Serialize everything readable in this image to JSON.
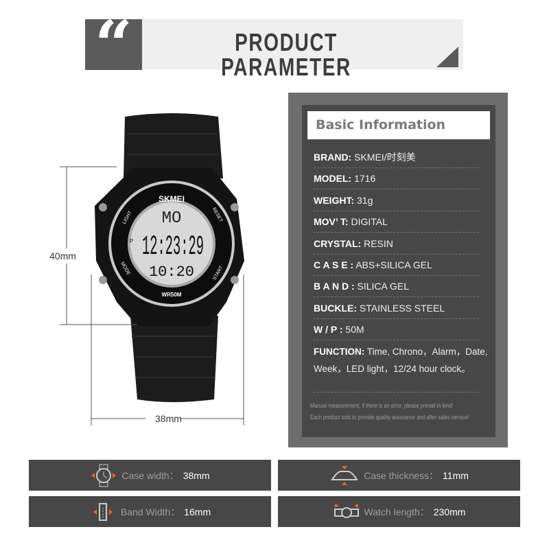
{
  "header": {
    "quote_icon": "quote-icon",
    "title": "PRODUCT PARAMETER"
  },
  "watch": {
    "brand": "SKMEI",
    "day": "MO",
    "time": "12:23:29",
    "sub_time": "10:20",
    "pm": "P",
    "light": "LIGHT",
    "reset": "RESET",
    "mode": "MODE",
    "start": "START",
    "wr": "WR50M"
  },
  "dimensions": {
    "height": "40mm",
    "width": "38mm"
  },
  "info": {
    "title": "Basic Information",
    "rows": [
      {
        "label": "BRAND:",
        "value": "SKMEI/时刻美"
      },
      {
        "label": "MODEL:",
        "value": "1716"
      },
      {
        "label": "WEIGHT:",
        "value": "31g"
      },
      {
        "label": "MOV’ T:",
        "value": "DIGITAL"
      },
      {
        "label": "CRYSTAL:",
        "value": "RESIN"
      },
      {
        "label": "C A S E :",
        "value": "ABS+SILICA GEL"
      },
      {
        "label": "B A N D :",
        "value": "SILICA GEL"
      },
      {
        "label": "BUCKLE:",
        "value": "STAINLESS STEEL"
      },
      {
        "label": "W / P :",
        "value": "50M"
      }
    ],
    "function_label": "FUNCTION:",
    "function_line1": "Time, Chrono，Alarm，Date,",
    "function_line2": "Week，LED light，12/24 hour clock。",
    "note1": "Manual measurement, if there is an error, please prevail in kind!",
    "note2": "Each product sold to provide quality assurance and after-sales service!"
  },
  "specs": [
    {
      "icon": "watch-width-icon",
      "label": "Case width：",
      "value": "38mm"
    },
    {
      "icon": "case-thickness-icon",
      "label": "Case thickness：",
      "value": "11mm"
    },
    {
      "icon": "band-width-icon",
      "label": "Band Width：",
      "value": "16mm"
    },
    {
      "icon": "watch-length-icon",
      "label": "Watch length：",
      "value": "230mm"
    }
  ],
  "colors": {
    "accent": "#e8642a",
    "panel": "#474747",
    "frame": "#6d6d6d"
  }
}
